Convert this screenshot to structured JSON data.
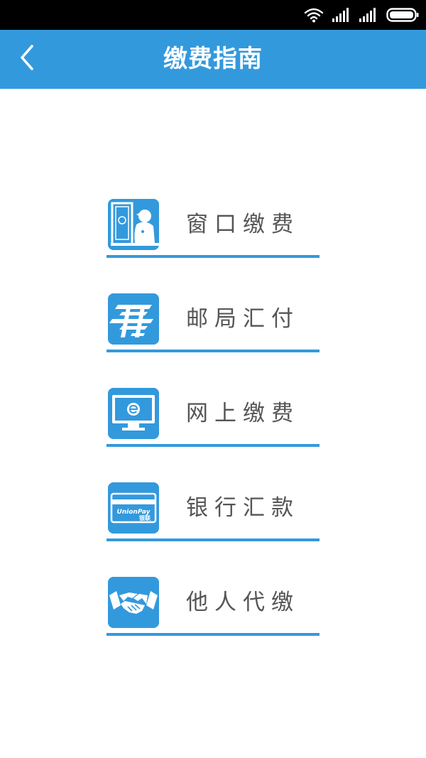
{
  "colors": {
    "accent": "#3399dd",
    "status_bar": "#000000",
    "label_text": "#555555",
    "background": "#ffffff"
  },
  "status_bar": {
    "icons": [
      "wifi-icon",
      "signal-icon",
      "signal-icon",
      "battery-icon"
    ]
  },
  "header": {
    "title": "缴费指南",
    "back_icon": "chevron-left-icon"
  },
  "menu": {
    "items": [
      {
        "label": "窗口缴费",
        "icon": "service-window-icon"
      },
      {
        "label": "邮局汇付",
        "icon": "china-post-icon"
      },
      {
        "label": "网上缴费",
        "icon": "computer-monitor-icon"
      },
      {
        "label": "银行汇款",
        "icon": "unionpay-card-icon",
        "icon_text": [
          "UnionPay",
          "银联"
        ]
      },
      {
        "label": "他人代缴",
        "icon": "handshake-icon"
      }
    ]
  }
}
